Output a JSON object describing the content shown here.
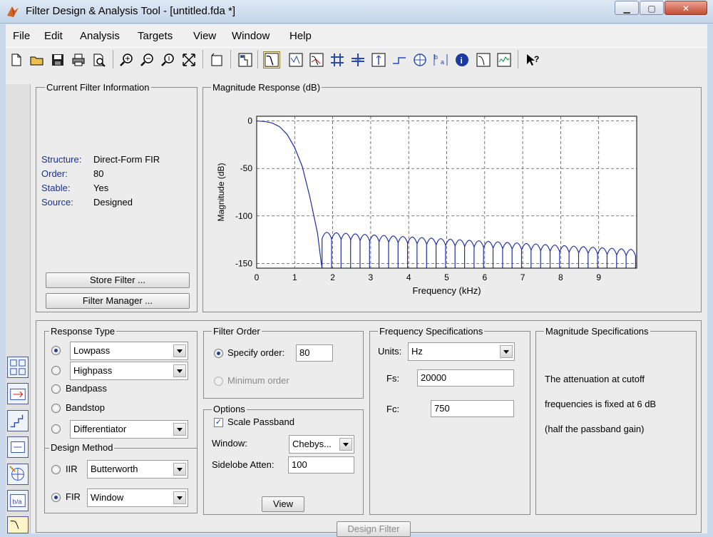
{
  "window": {
    "title": "Filter Design & Analysis Tool -  [untitled.fda *]",
    "minimize": "▁",
    "maximize": "▢",
    "close": "✕"
  },
  "menu": [
    "File",
    "Edit",
    "Analysis",
    "Targets",
    "View",
    "Window",
    "Help"
  ],
  "filter_info": {
    "legend": "Current Filter Information",
    "rows": [
      {
        "label": "Structure:",
        "value": "Direct-Form FIR"
      },
      {
        "label": "Order:",
        "value": "80"
      },
      {
        "label": "Stable:",
        "value": "Yes"
      },
      {
        "label": "Source:",
        "value": "Designed"
      }
    ],
    "store_button": "Store Filter ...",
    "manager_button": "Filter Manager ..."
  },
  "magnitude_panel": {
    "legend": "Magnitude Response (dB)"
  },
  "chart_data": {
    "type": "line",
    "title": "",
    "xlabel": "Frequency (kHz)",
    "ylabel": "Magnitude (dB)",
    "xlim": [
      0,
      10
    ],
    "ylim": [
      -155,
      5
    ],
    "xticks": [
      0,
      1,
      2,
      3,
      4,
      5,
      6,
      7,
      8,
      9
    ],
    "yticks": [
      0,
      -50,
      -100,
      -150
    ],
    "grid": true,
    "series": [
      {
        "x": [
          0,
          0.2,
          0.4,
          0.6,
          0.8,
          1.0,
          1.2,
          1.4,
          1.6,
          1.7
        ],
        "y": [
          0,
          -0.5,
          -2,
          -6,
          -14,
          -28,
          -48,
          -80,
          -118,
          -150
        ]
      }
    ],
    "stopband": {
      "start_khz": 1.72,
      "end_khz": 10,
      "lobe_spacing_khz": 0.25,
      "peak_start_db": -115,
      "peak_end_db": -133,
      "null_db": -152
    },
    "line_color": "#1f2fa8"
  },
  "response_type": {
    "legend": "Response Type",
    "options": [
      {
        "label": "Lowpass",
        "selected": true,
        "combo": true
      },
      {
        "label": "Highpass",
        "selected": false,
        "combo": true
      },
      {
        "label": "Bandpass",
        "selected": false,
        "combo": false
      },
      {
        "label": "Bandstop",
        "selected": false,
        "combo": false
      },
      {
        "label": "Differentiator",
        "selected": false,
        "combo": true
      }
    ]
  },
  "design_method": {
    "legend": "Design Method",
    "iir_label": "IIR",
    "iir_value": "Butterworth",
    "fir_label": "FIR",
    "fir_value": "Window"
  },
  "filter_order": {
    "legend": "Filter Order",
    "specify_label": "Specify order:",
    "specify_value": "80",
    "minimum_label": "Minimum order"
  },
  "options": {
    "legend": "Options",
    "scale_passband_label": "Scale Passband",
    "window_label": "Window:",
    "window_value": "Chebys...",
    "sidelobe_label": "Sidelobe Atten:",
    "sidelobe_value": "100",
    "view_button": "View"
  },
  "frequency_specs": {
    "legend": "Frequency Specifications",
    "units_label": "Units:",
    "units_value": "Hz",
    "fs_label": "Fs:",
    "fs_value": "20000",
    "fc_label": "Fc:",
    "fc_value": "750"
  },
  "magnitude_specs": {
    "legend": "Magnitude Specifications",
    "line1": "The attenuation at cutoff",
    "line2": "frequencies is fixed at 6 dB",
    "line3": "(half the passband gain)"
  },
  "design_button": "Design Filter"
}
